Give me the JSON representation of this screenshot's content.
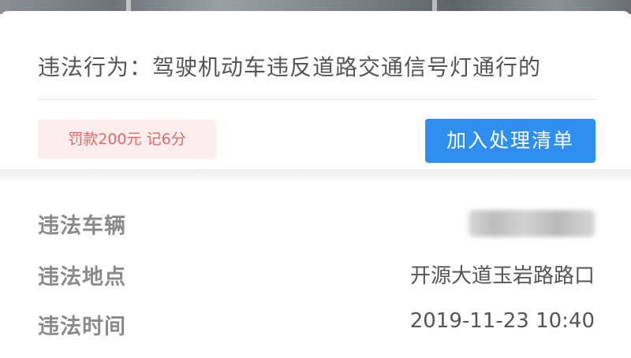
{
  "violation": {
    "behavior_text": "违法行为：驾驶机动车违反道路交通信号灯通行的",
    "penalty": "罚款200元 记6分",
    "add_button_label": "加入处理清单"
  },
  "details": [
    {
      "label": "违法车辆",
      "value": ""
    },
    {
      "label": "违法地点",
      "value": "开源大道玉岩路路口"
    },
    {
      "label": "违法时间",
      "value": "2019-11-23 10:40"
    }
  ],
  "colors": {
    "accent": "#2f8ff0",
    "penalty_text": "#e16b6b",
    "penalty_bg": "#fdeeee"
  }
}
